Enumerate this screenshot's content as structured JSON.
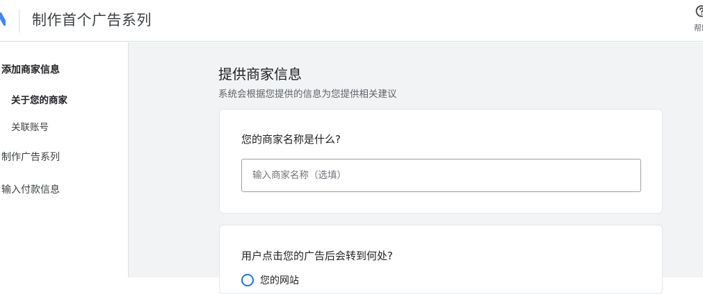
{
  "header": {
    "title": "制作首个广告系列",
    "help_label": "帮助"
  },
  "sidebar": {
    "items": [
      {
        "label": "添加商家信息"
      },
      {
        "label": "关于您的商家"
      },
      {
        "label": "关联账号"
      },
      {
        "label": "制作广告系列"
      },
      {
        "label": "输入付款信息"
      }
    ]
  },
  "main": {
    "title": "提供商家信息",
    "subtitle": "系统会根据您提供的信息为您提供相关建议",
    "business_name": {
      "question": "您的商家名称是什么?",
      "value": "",
      "placeholder": "输入商家名称（选填）"
    },
    "destination": {
      "question": "用户点击您的广告后会转到何处?",
      "option_label": "您的网站"
    }
  },
  "colors": {
    "accent": "#1a73e8",
    "logo_blue": "#4285f4",
    "main_background": "#f1f3f4"
  },
  "icons": [
    "google-ads-logo-icon",
    "help-circle-icon"
  ]
}
